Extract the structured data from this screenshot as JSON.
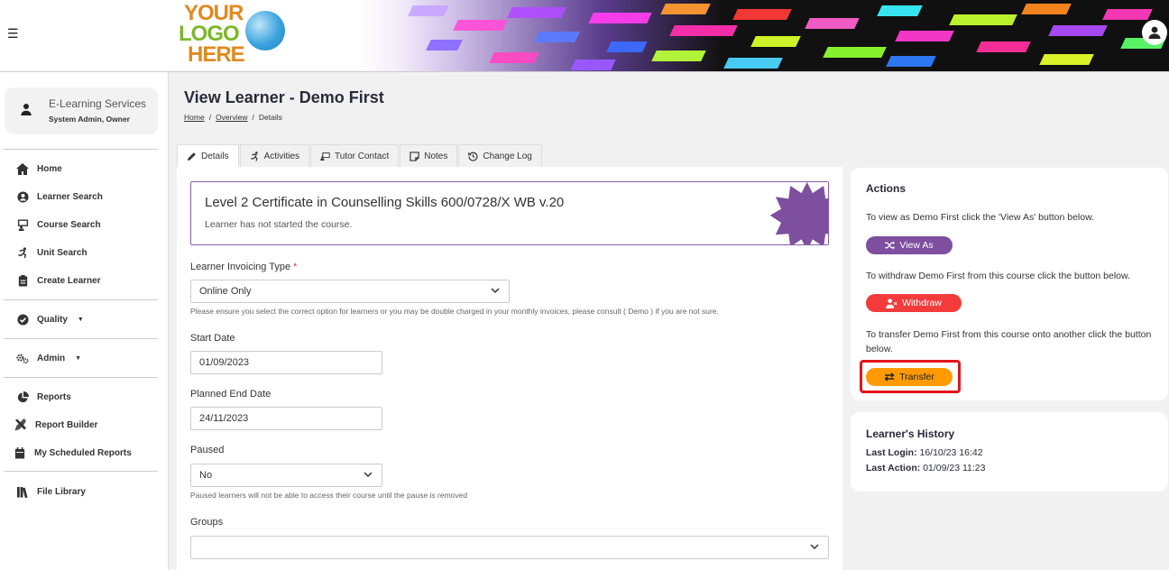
{
  "header": {
    "logo": {
      "line1": "YOUR",
      "line2": "LOGO",
      "line3": "HERE"
    }
  },
  "sidebar": {
    "profile": {
      "name": "E-Learning Services",
      "role": "System Admin, Owner"
    },
    "items": [
      {
        "label": "Home",
        "icon": "home-icon"
      },
      {
        "label": "Learner Search",
        "icon": "user-circle-icon"
      },
      {
        "label": "Course Search",
        "icon": "teacher-icon"
      },
      {
        "label": "Unit Search",
        "icon": "running-icon"
      },
      {
        "label": "Create Learner",
        "icon": "clipboard-icon"
      },
      {
        "label": "Quality",
        "icon": "check-circle-icon"
      },
      {
        "label": "Admin",
        "icon": "cogs-icon"
      },
      {
        "label": "Reports",
        "icon": "pie-chart-icon"
      },
      {
        "label": "Report Builder",
        "icon": "tools-icon"
      },
      {
        "label": "My Scheduled Reports",
        "icon": "calendar-icon"
      },
      {
        "label": "File Library",
        "icon": "books-icon"
      }
    ]
  },
  "page": {
    "title": "View Learner - Demo First",
    "breadcrumb": [
      "Home",
      "Overview",
      "Details"
    ],
    "breadcrumb_sep": "/"
  },
  "tabs": [
    {
      "label": "Details",
      "icon": "pencil-icon",
      "active": true
    },
    {
      "label": "Activities",
      "icon": "running-icon",
      "active": false
    },
    {
      "label": "Tutor Contact",
      "icon": "chalkboard-icon",
      "active": false
    },
    {
      "label": "Notes",
      "icon": "note-icon",
      "active": false
    },
    {
      "label": "Change Log",
      "icon": "history-icon",
      "active": false
    }
  ],
  "course": {
    "title": "Level 2 Certificate in Counselling Skills 600/0728/X WB v.20",
    "status": "Learner has not started the course."
  },
  "form": {
    "invoicing_label": "Learner Invoicing Type",
    "required_mark": "*",
    "invoicing_value": "Online Only",
    "invoicing_hint": "Please ensure you select the correct option for learners or you may be double charged in your monthly invoices, please consult ( Demo ) if you are not sure.",
    "start_label": "Start Date",
    "start_value": "01/09/2023",
    "end_label": "Planned End Date",
    "end_value": "24/11/2023",
    "paused_label": "Paused",
    "paused_value": "No",
    "paused_hint": "Paused learners will not be able to access their course until the pause is removed",
    "groups_label": "Groups",
    "groups_value": ""
  },
  "actions": {
    "title": "Actions",
    "view_as_text": "To view as Demo First click the 'View As' button below.",
    "view_as_label": "View As",
    "withdraw_text": "To withdraw Demo First from this course click the button below.",
    "withdraw_label": "Withdraw",
    "transfer_text": "To transfer Demo First from this course onto another click the button below.",
    "transfer_label": "Transfer",
    "colors": {
      "view_as": "#7d4f9e",
      "withdraw": "#f33b3b",
      "transfer": "#ff9b00",
      "highlight": "#e3151b"
    }
  },
  "history": {
    "title": "Learner's History",
    "last_login_label": "Last Login:",
    "last_login_value": "16/10/23 16:42",
    "last_action_label": "Last Action:",
    "last_action_value": "01/09/23 11:23"
  }
}
